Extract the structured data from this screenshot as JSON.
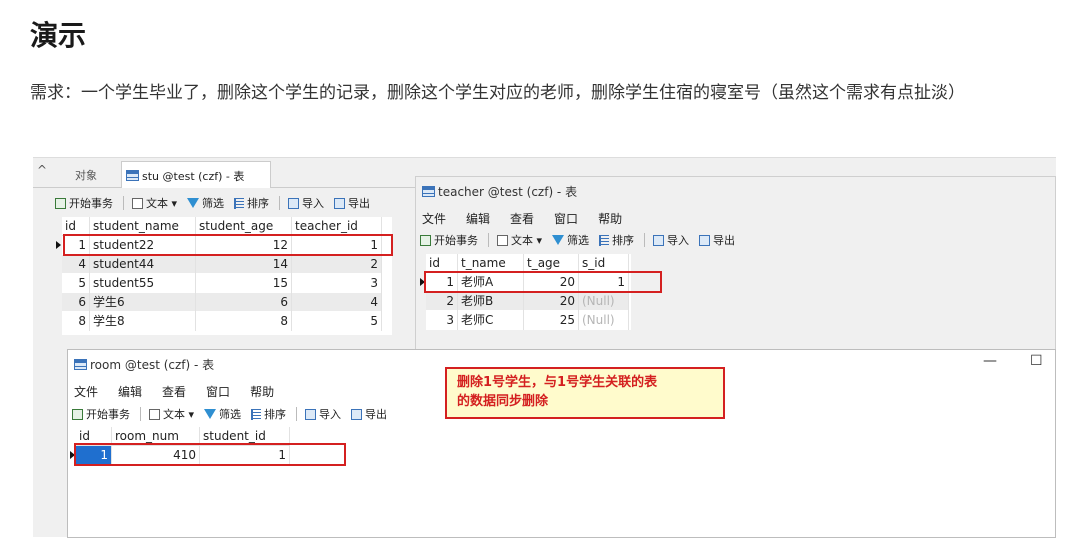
{
  "article": {
    "heading": "演示",
    "description": "需求：一个学生毕业了，删除这个学生的记录，删除这个学生对应的老师，删除学生住宿的寝室号（虽然这个需求有点扯淡）"
  },
  "stu_window": {
    "tab_objects": "对象",
    "tab_title": "stu @test (czf) - 表",
    "toolbar": {
      "begin_tx": "开始事务",
      "text": "文本 ▾",
      "filter": "筛选",
      "sort": "排序",
      "import": "导入",
      "export": "导出"
    },
    "columns": [
      "id",
      "student_name",
      "student_age",
      "teacher_id"
    ],
    "rows": [
      [
        "1",
        "student22",
        "12",
        "1"
      ],
      [
        "4",
        "student44",
        "14",
        "2"
      ],
      [
        "5",
        "student55",
        "15",
        "3"
      ],
      [
        "6",
        "学生6",
        "6",
        "4"
      ],
      [
        "8",
        "学生8",
        "8",
        "5"
      ]
    ]
  },
  "teacher_window": {
    "title": "teacher @test (czf) - 表",
    "menu": [
      "文件",
      "编辑",
      "查看",
      "窗口",
      "帮助"
    ],
    "toolbar": {
      "begin_tx": "开始事务",
      "text": "文本 ▾",
      "filter": "筛选",
      "sort": "排序",
      "import": "导入",
      "export": "导出"
    },
    "columns": [
      "id",
      "t_name",
      "t_age",
      "s_id"
    ],
    "rows": [
      [
        "1",
        "老师A",
        "20",
        "1"
      ],
      [
        "2",
        "老师B",
        "20",
        "(Null)"
      ],
      [
        "3",
        "老师C",
        "25",
        "(Null)"
      ]
    ]
  },
  "room_window": {
    "title": "room @test (czf) - 表",
    "menu": [
      "文件",
      "编辑",
      "查看",
      "窗口",
      "帮助"
    ],
    "toolbar": {
      "begin_tx": "开始事务",
      "text": "文本 ▾",
      "filter": "筛选",
      "sort": "排序",
      "import": "导入",
      "export": "导出"
    },
    "controls": {
      "minimize": "—",
      "maximize": "☐"
    },
    "columns": [
      "id",
      "room_num",
      "student_id"
    ],
    "rows": [
      [
        "1",
        "410",
        "1"
      ]
    ]
  },
  "annotation": {
    "line1": "删除1号学生，与1号学生关联的表",
    "line2": "的数据同步删除",
    "border_color": "#d42020"
  }
}
